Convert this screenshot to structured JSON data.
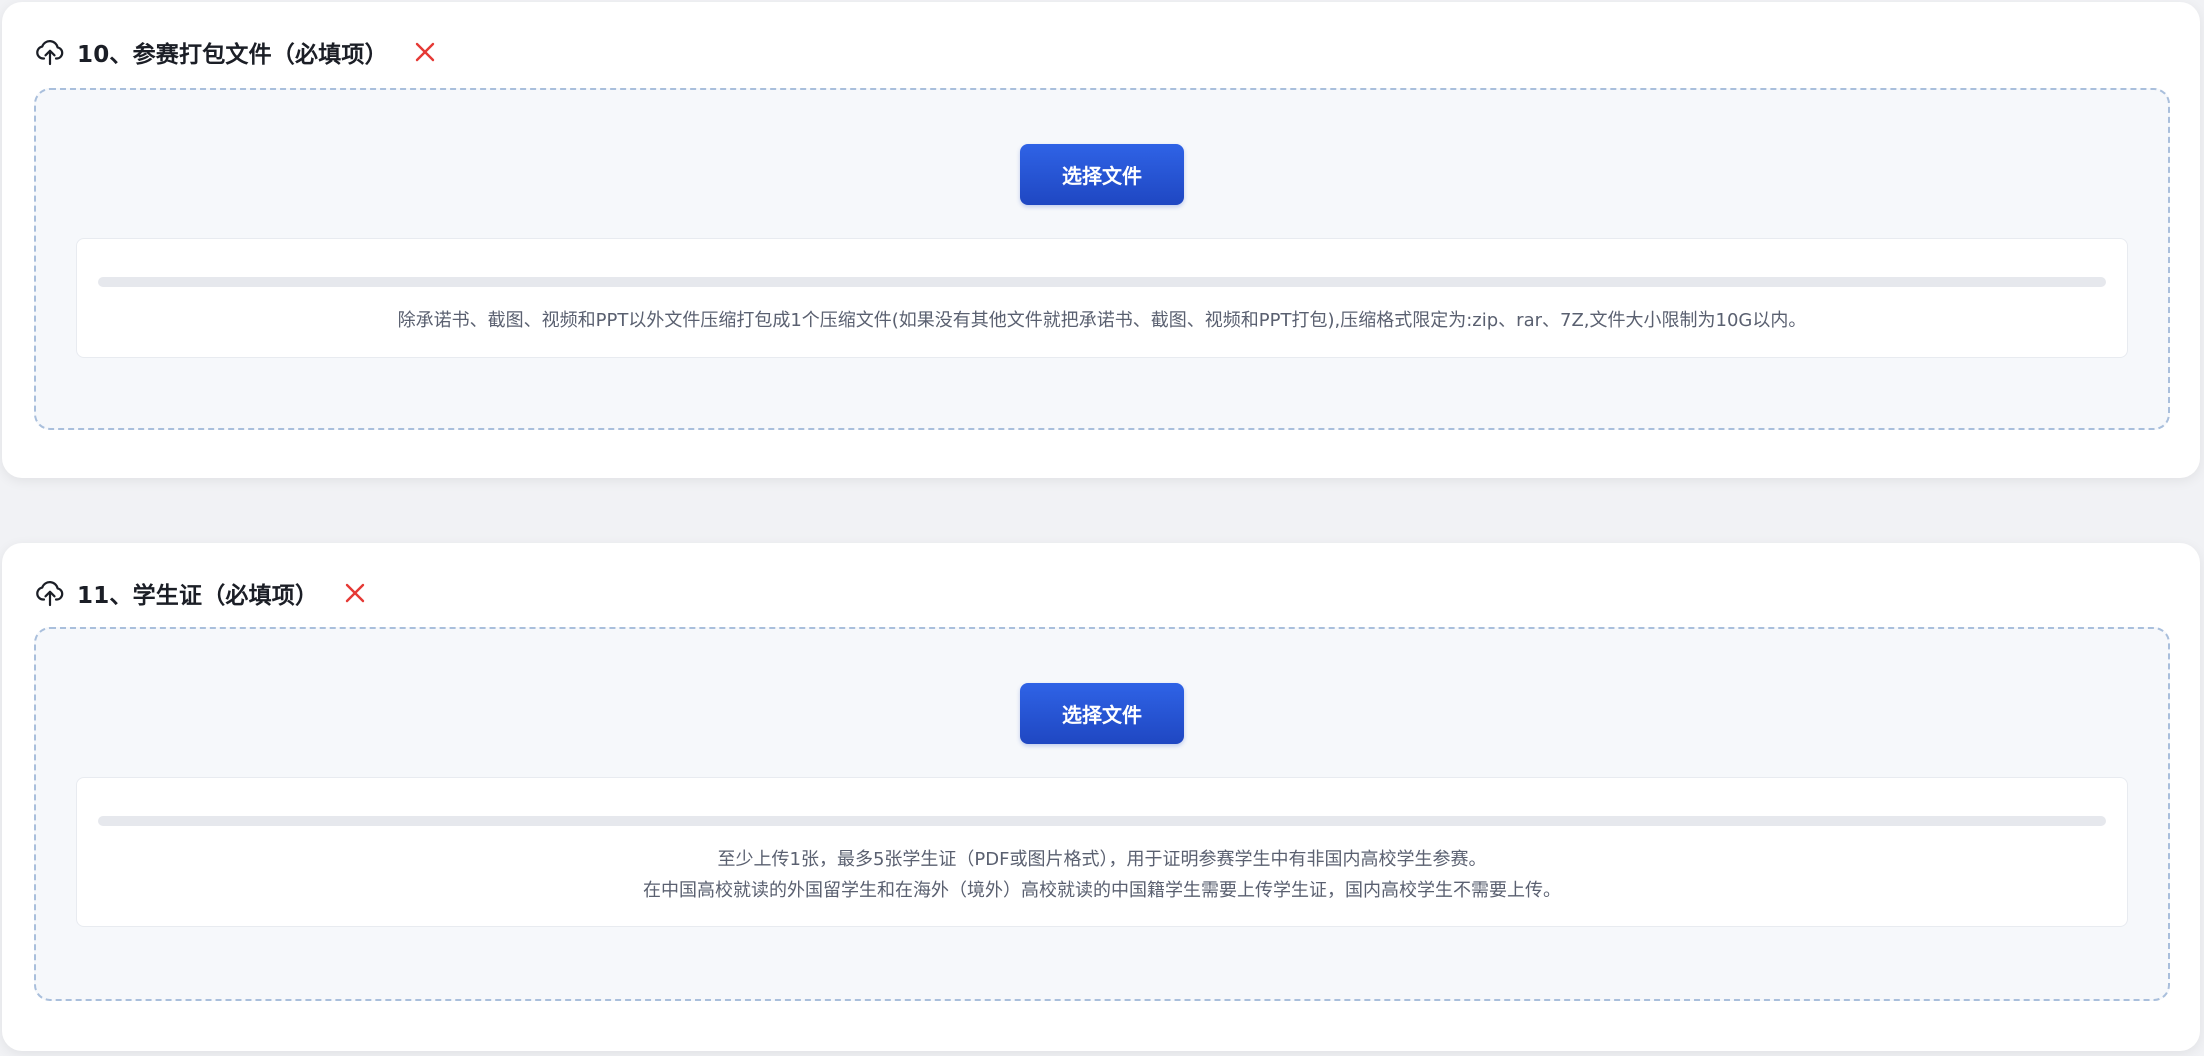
{
  "sections": [
    {
      "title": "10、参赛打包文件（必填项）",
      "select_button_label": "选择文件",
      "upload_progress": 0,
      "hint_lines": [
        "除承诺书、截图、视频和PPT以外文件压缩打包成1个压缩文件(如果没有其他文件就把承诺书、截图、视频和PPT打包),压缩格式限定为:zip、rar、7Z,文件大小限制为10G以内。"
      ]
    },
    {
      "title": "11、学生证（必填项）",
      "select_button_label": "选择文件",
      "upload_progress": 0,
      "hint_lines": [
        "至少上传1张，最多5张学生证（PDF或图片格式），用于证明参赛学生中有非国内高校学生参赛。",
        "在中国高校就读的外国留学生和在海外（境外）高校就读的中国籍学生需要上传学生证，国内高校学生不需要上传。"
      ]
    }
  ],
  "icons": {
    "section_icon": "cloud-upload-icon",
    "remove_icon": "close-icon"
  },
  "colors": {
    "primary_button": "#2f63e6",
    "remove_icon": "#e53935",
    "dropzone_border": "#a9bfdc"
  }
}
